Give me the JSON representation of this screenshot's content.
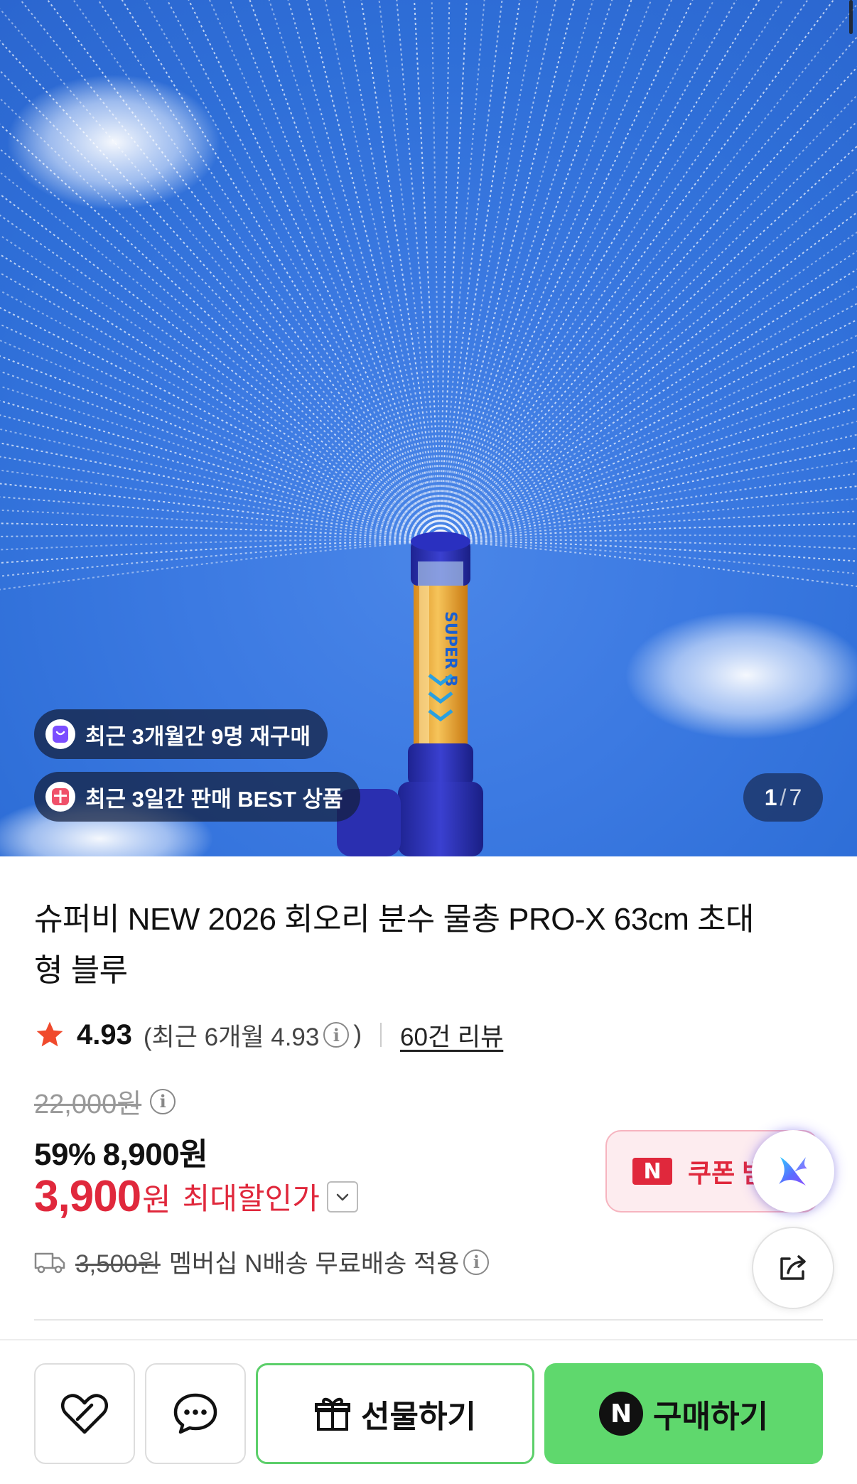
{
  "hero": {
    "badges": [
      {
        "icon": "shopping-bag-icon",
        "text": "최근 3개월간 9명 재구매"
      },
      {
        "icon": "gift-box-icon",
        "text": "최근 3일간 판매 BEST 상품"
      }
    ],
    "counter": {
      "current": "1",
      "separator": "/",
      "total": "7"
    },
    "colors": {
      "sky": "#3c7ae2",
      "product_body": "#f0a832",
      "product_cap": "#2a2fb0"
    }
  },
  "product": {
    "title": "슈퍼비 NEW 2026 회오리 분수 물총 PRO-X 63cm 초대형 블루",
    "rating": {
      "score": "4.93",
      "recent_prefix": "(최근 6개월 4.93",
      "recent_suffix": ")",
      "reviews": "60건 리뷰"
    },
    "original_price": "22,000원",
    "sale": {
      "percent": "59%",
      "price": "8,900원"
    },
    "max_discount": {
      "price": "3,900",
      "unit": "원",
      "label": "최대할인가"
    },
    "shipping": {
      "old_fee": "3,500원",
      "text": "멤버십 N배송 무료배송 적용"
    }
  },
  "coupon": {
    "badge": "N",
    "text": "쿠폰 받기"
  },
  "actions": {
    "gift_label": "선물하기",
    "buy_badge": "N",
    "buy_label": "구매하기"
  },
  "colors": {
    "accent_red": "#e0283c",
    "buy_green": "#5fd86d",
    "gift_border": "#5ccf6a"
  }
}
